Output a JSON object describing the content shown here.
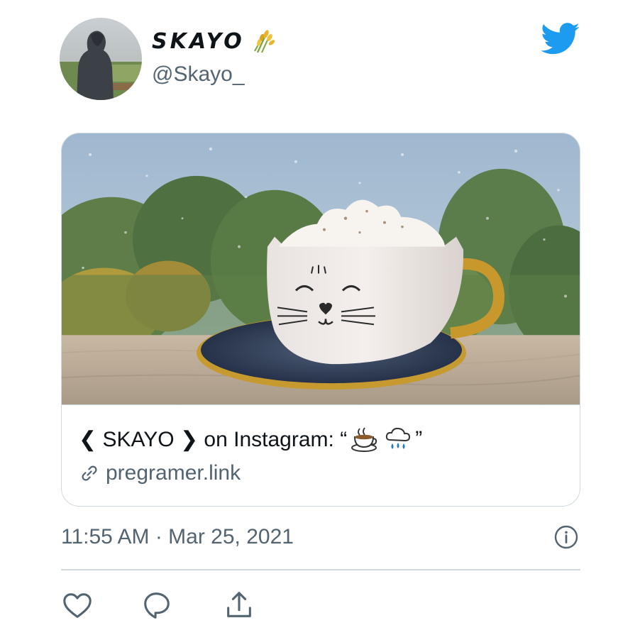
{
  "author": {
    "display_name": "SKAYO",
    "name_emoji": "sheaf-of-rice-icon",
    "handle": "@Skayo_"
  },
  "brand_icon": "twitter-bird-icon",
  "card": {
    "title_prefix": "❮ SKAYO ❯ on Instagram: “",
    "title_suffix": "”",
    "title_emojis": [
      "hot-beverage-icon",
      "cloud-with-rain-icon"
    ],
    "link_text": "pregramer.link"
  },
  "timestamp": "11:55 AM · Mar 25, 2021",
  "actions": [
    "like-icon",
    "reply-icon",
    "share-icon"
  ],
  "colors": {
    "brand_blue": "#1d9bf0",
    "secondary_text": "#536471",
    "border": "#cfd9de"
  }
}
